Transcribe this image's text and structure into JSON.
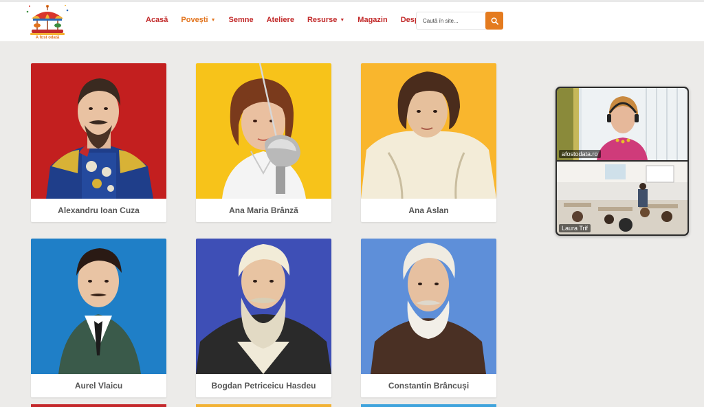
{
  "header": {
    "logo_text": "A fost odată",
    "nav": [
      {
        "label": "Acasă",
        "active": false,
        "dropdown": false
      },
      {
        "label": "Povești",
        "active": true,
        "dropdown": true
      },
      {
        "label": "Semne",
        "active": false,
        "dropdown": false
      },
      {
        "label": "Ateliere",
        "active": false,
        "dropdown": false
      },
      {
        "label": "Resurse",
        "active": false,
        "dropdown": true
      },
      {
        "label": "Magazin",
        "active": false,
        "dropdown": false
      },
      {
        "label": "Despre",
        "active": false,
        "dropdown": false
      }
    ],
    "search_placeholder": "Caută în site...",
    "search_icon": "search-icon"
  },
  "cards": [
    {
      "name": "Alexandru Ioan Cuza",
      "bg": "#c31f1f"
    },
    {
      "name": "Ana Maria Brânză",
      "bg": "#f7c31a"
    },
    {
      "name": "Ana Aslan",
      "bg": "#f9b62d"
    },
    {
      "name": "Aurel Vlaicu",
      "bg": "#1f7fc7"
    },
    {
      "name": "Bogdan Petriceicu Hasdeu",
      "bg": "#3e4fb6"
    },
    {
      "name": "Constantin Brâncuși",
      "bg": "#5e8fd9"
    }
  ],
  "bottom_strip_colors": [
    "#c4282b",
    "#f2b234",
    "#3fa3dc"
  ],
  "video_call": {
    "participants": [
      {
        "name": "afostodata.ro"
      },
      {
        "name": "Laura Trif"
      }
    ]
  },
  "colors": {
    "accent": "#e47b1f",
    "nav_red": "#c22a2a",
    "page_bg": "#ecebe9"
  }
}
